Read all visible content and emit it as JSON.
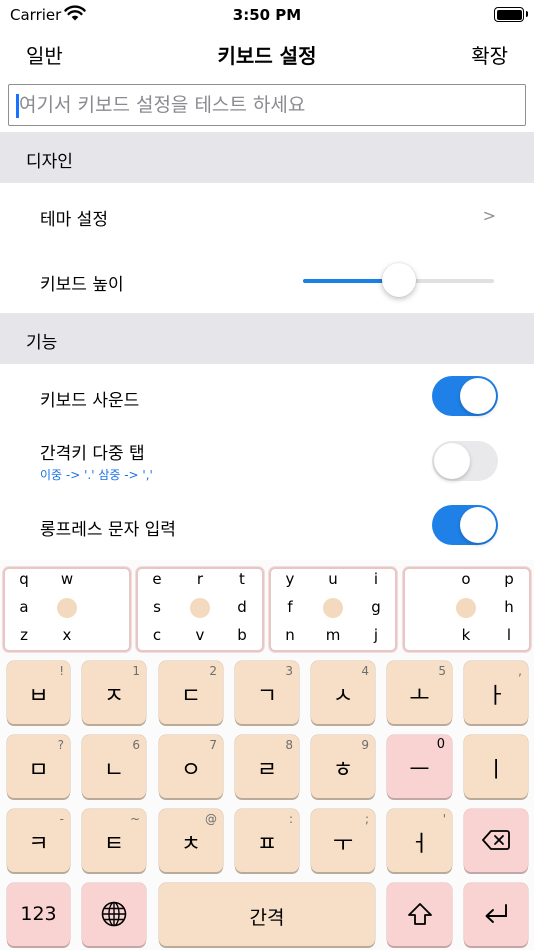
{
  "status_bar": {
    "carrier": "Carrier",
    "time": "3:50 PM"
  },
  "nav": {
    "back": "일반",
    "title": "키보드 설정",
    "right": "확장"
  },
  "test_input": {
    "placeholder": "여기서 키보드 설정을 테스트 하세요",
    "value": ""
  },
  "sections": {
    "design": {
      "header": "디자인",
      "theme_label": "테마 설정",
      "theme_chevron": ">",
      "height_label": "키보드 높이",
      "height_value": 0.5
    },
    "function": {
      "header": "기능",
      "sound_label": "키보드 사운드",
      "sound_on": true,
      "multitap_label": "간격키 다중 탭",
      "multitap_sub": "이중 -> '.' 삼중 -> ','",
      "multitap_on": false,
      "longpress_label": "롱프레스 문자 입력",
      "longpress_on": true
    }
  },
  "keyboard": {
    "preview_boxes": [
      {
        "letters": [
          "q",
          "w",
          "a",
          "",
          "z",
          "x"
        ]
      },
      {
        "letters": [
          "e",
          "r",
          "t",
          "s",
          "d",
          "c",
          "v",
          "b"
        ]
      },
      {
        "letters": [
          "y",
          "u",
          "i",
          "f",
          "g",
          "n",
          "m",
          "j"
        ]
      },
      {
        "letters": [
          "o",
          "p",
          "h",
          "k",
          "l"
        ]
      }
    ],
    "row1": [
      {
        "main": "ㅂ",
        "hint": "!"
      },
      {
        "main": "ㅈ",
        "hint": "1"
      },
      {
        "main": "ㄷ",
        "hint": "2"
      },
      {
        "main": "ㄱ",
        "hint": "3"
      },
      {
        "main": "ㅅ",
        "hint": "4"
      },
      {
        "main": "ㅗ",
        "hint": "5"
      },
      {
        "main": "ㅏ",
        "hint": ","
      }
    ],
    "row2": [
      {
        "main": "ㅁ",
        "hint": "?"
      },
      {
        "main": "ㄴ",
        "hint": "6"
      },
      {
        "main": "ㅇ",
        "hint": "7"
      },
      {
        "main": "ㄹ",
        "hint": "8"
      },
      {
        "main": "ㅎ",
        "hint": "9"
      },
      {
        "main": "ㅡ",
        "hint": "0"
      },
      {
        "main": "ㅣ",
        "hint": ""
      }
    ],
    "row3": [
      {
        "main": "ㅋ",
        "hint": "-"
      },
      {
        "main": "ㅌ",
        "hint": "~"
      },
      {
        "main": "ㅊ",
        "hint": "@"
      },
      {
        "main": "ㅍ",
        "hint": ":"
      },
      {
        "main": "ㅜ",
        "hint": ";"
      },
      {
        "main": "ㅓ",
        "hint": "'"
      }
    ],
    "numbers_label": "123",
    "space_label": "간격",
    "icons": {
      "delete": "delete-icon",
      "globe": "globe-icon",
      "shift": "shift-icon",
      "return": "return-icon"
    },
    "colors": {
      "key": "#f6dfc6",
      "key_pink": "#f8d3d2",
      "accent": "#1f80e8"
    }
  }
}
